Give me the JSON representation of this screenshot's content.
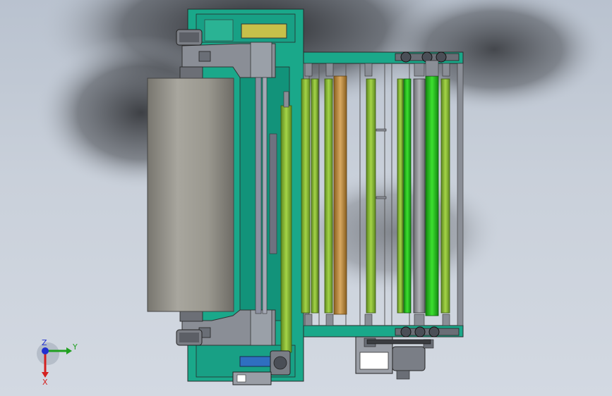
{
  "view": {
    "type": "cad-model-viewport",
    "colors": {
      "background": "#c4ccd7",
      "frame_teal": "#1aa88a",
      "steel_gray": "#8a8e96",
      "drum_gray": "#9f9d95",
      "roller_green": "#8fc23a",
      "roller_bright_green": "#22c21a",
      "roller_bronze": "#c09048",
      "accent_yellow": "#c7c04a",
      "accent_blue": "#2f6fc0"
    }
  },
  "triad": {
    "axis_z": "Z",
    "axis_y": "Y",
    "axis_x": "X",
    "colors": {
      "x": "#d42020",
      "y": "#20a020",
      "z": "#2030d0"
    }
  }
}
